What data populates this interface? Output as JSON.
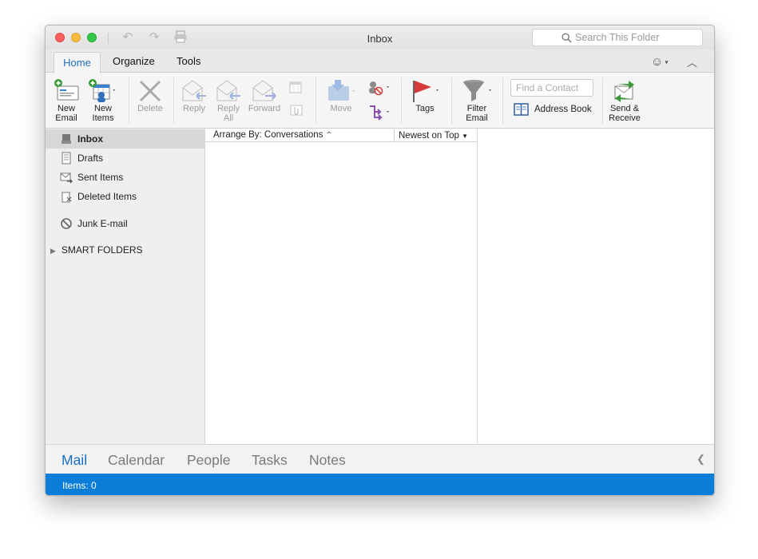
{
  "window": {
    "title": "Inbox",
    "search_placeholder": "Search This Folder"
  },
  "tabs": [
    {
      "label": "Home",
      "active": true
    },
    {
      "label": "Organize"
    },
    {
      "label": "Tools"
    }
  ],
  "ribbon": {
    "new_email": [
      "New",
      "Email"
    ],
    "new_items": [
      "New",
      "Items"
    ],
    "delete": "Delete",
    "reply": "Reply",
    "reply_all": [
      "Reply",
      "All"
    ],
    "forward": "Forward",
    "move": "Move",
    "tags": "Tags",
    "filter_email": [
      "Filter",
      "Email"
    ],
    "find_contact_placeholder": "Find a Contact",
    "address_book": "Address Book",
    "send_receive": [
      "Send &",
      "Receive"
    ]
  },
  "folders": [
    {
      "label": "Inbox",
      "icon": "inbox-icon",
      "selected": true
    },
    {
      "label": "Drafts",
      "icon": "drafts-icon"
    },
    {
      "label": "Sent Items",
      "icon": "sent-icon"
    },
    {
      "label": "Deleted Items",
      "icon": "trash-icon"
    },
    {
      "label": "Junk E-mail",
      "icon": "junk-icon"
    }
  ],
  "smart_folders": "SMART FOLDERS",
  "list": {
    "arrange_by": "Arrange By: Conversations",
    "sort": "Newest on Top"
  },
  "nav": [
    "Mail",
    "Calendar",
    "People",
    "Tasks",
    "Notes"
  ],
  "status": {
    "items": "Items: 0"
  },
  "colors": {
    "accent": "#0a7dd8",
    "nav_active": "#1a6ec1"
  }
}
